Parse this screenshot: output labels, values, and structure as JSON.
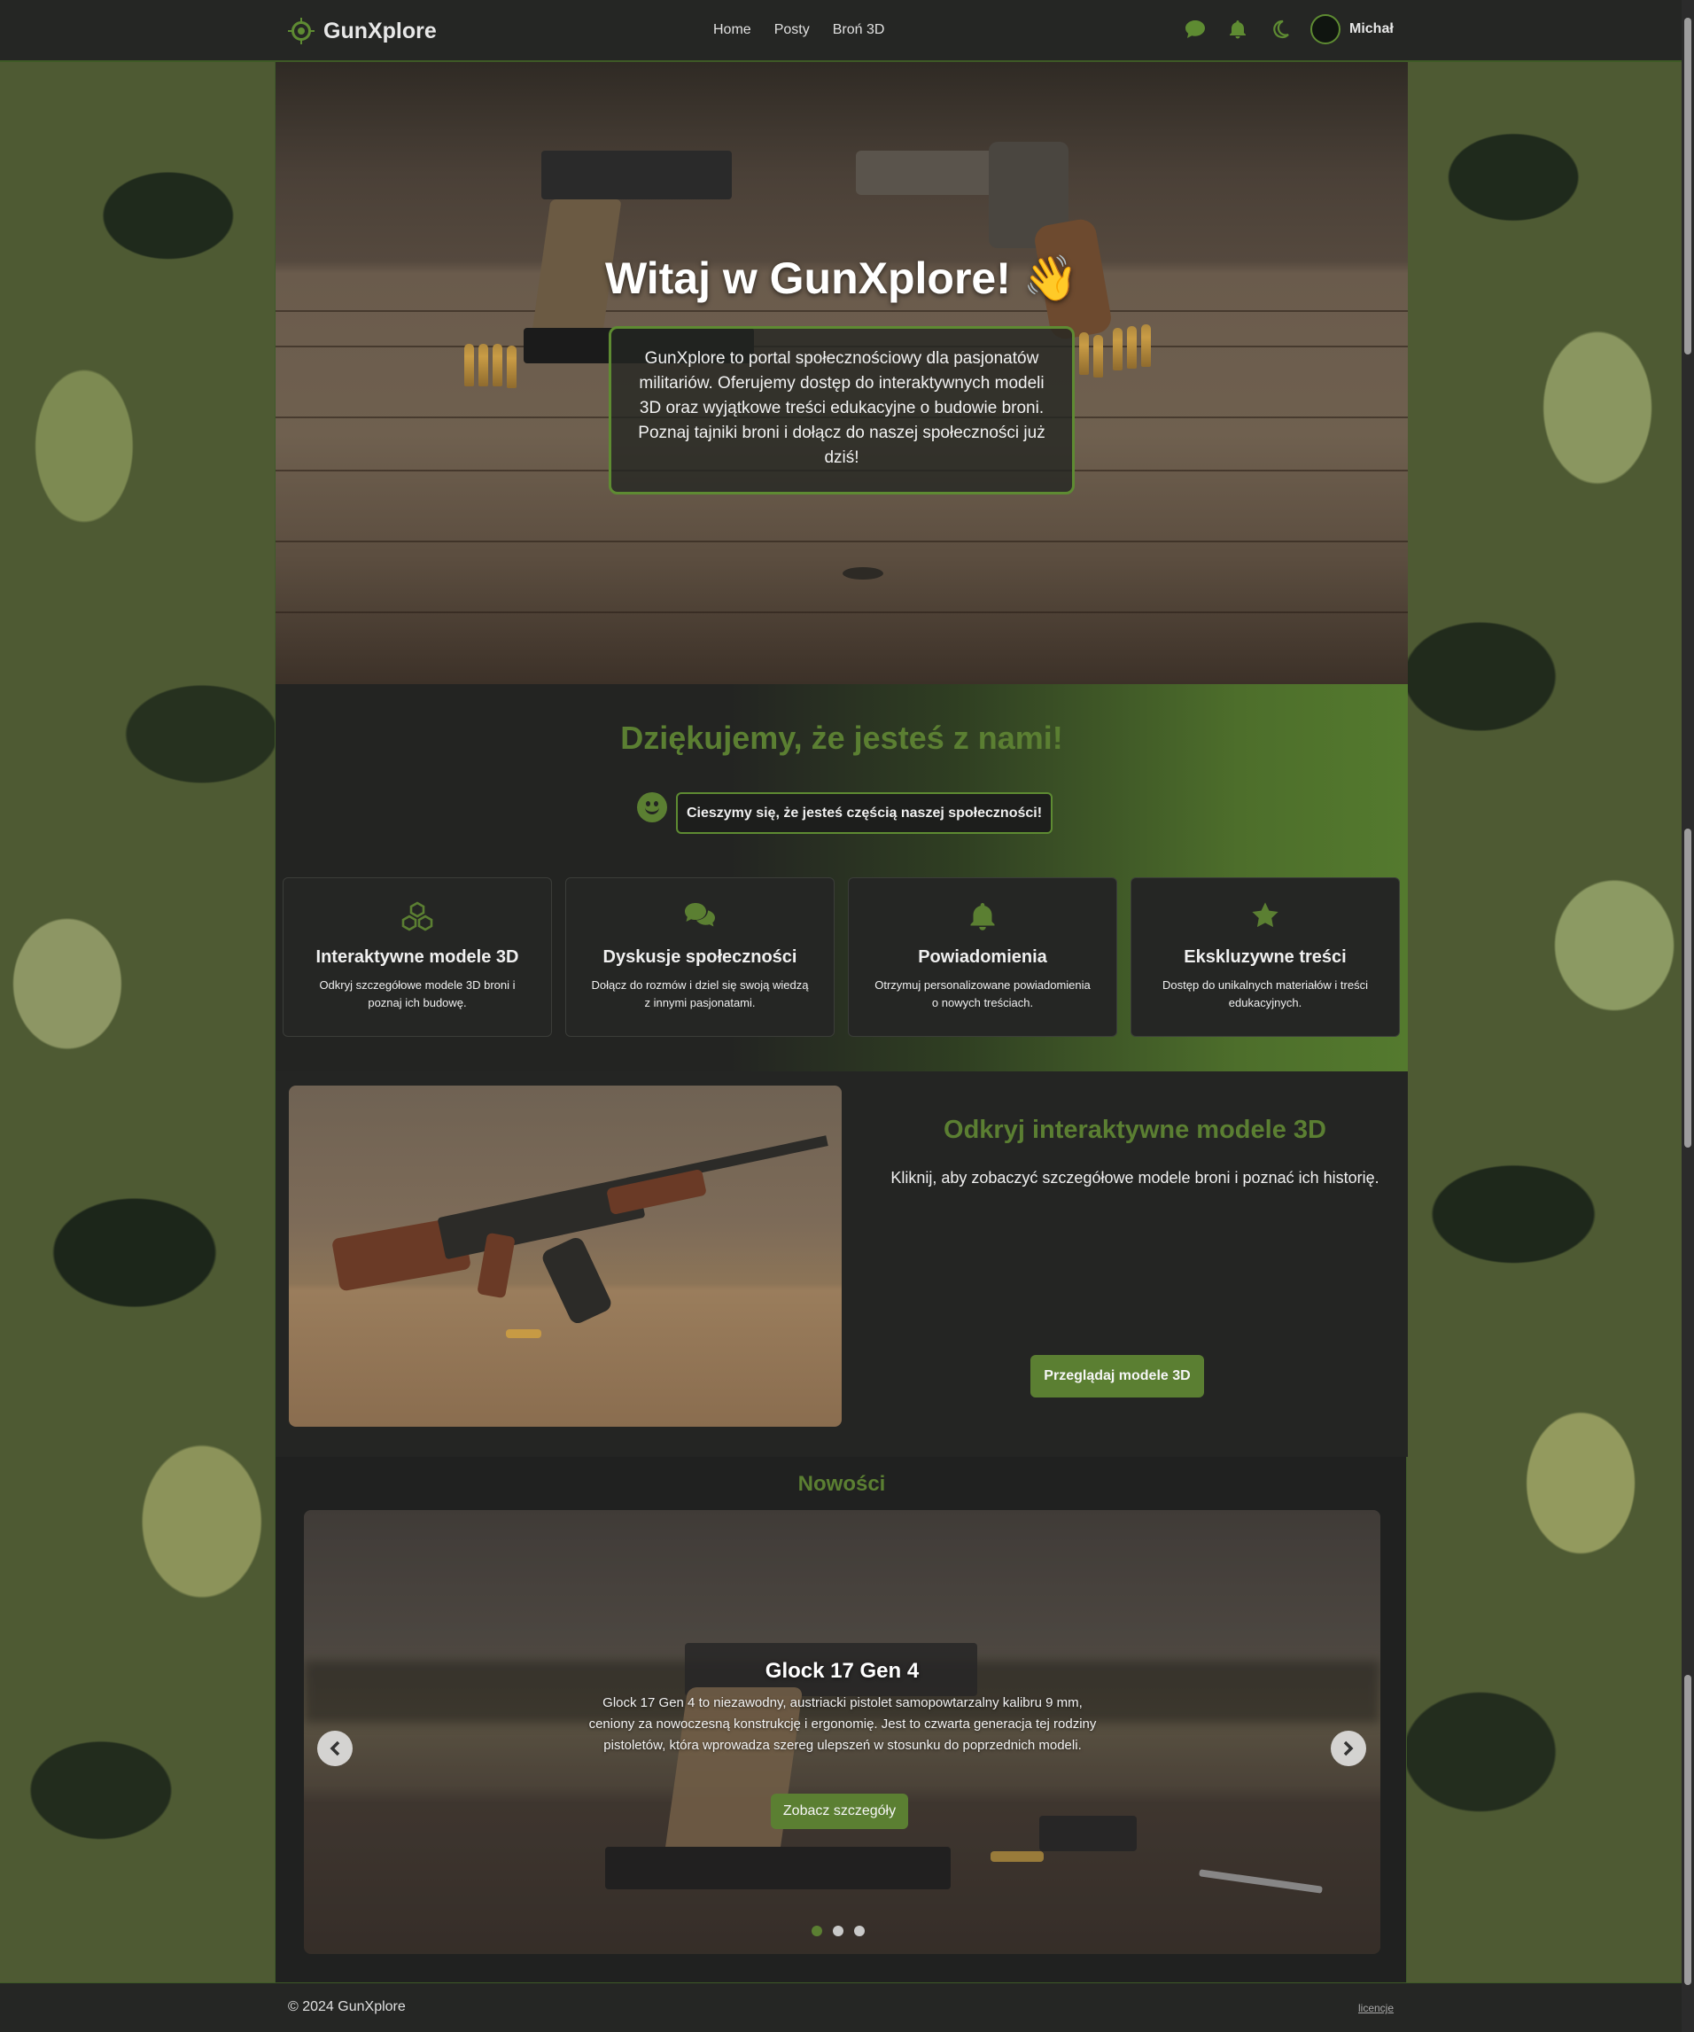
{
  "header": {
    "brand": "GunXplore",
    "nav": [
      "Home",
      "Posty",
      "Broń 3D"
    ],
    "icons": [
      "chat-icon",
      "bell-icon",
      "moon-icon"
    ],
    "user": "Michał"
  },
  "hero": {
    "title": "Witaj w GunXplore! 👋",
    "text": "GunXplore to portal społecznościowy dla pasjonatów militariów. Oferujemy dostęp do interaktywnych modeli 3D oraz wyjątkowe treści edukacyjne o budowie broni. Poznaj tajniki broni i dołącz do naszej społeczności już dziś!"
  },
  "thanks": {
    "title": "Dziękujemy, że jesteś z nami!",
    "pill": "Cieszymy się, że jesteś częścią naszej społeczności!"
  },
  "features": [
    {
      "icon": "cubes-icon",
      "title": "Interaktywne modele 3D",
      "text": "Odkryj szczegółowe modele 3D broni i poznaj ich budowę."
    },
    {
      "icon": "comments-icon",
      "title": "Dyskusje społeczności",
      "text": "Dołącz do rozmów i dziel się swoją wiedzą z innymi pasjonatami."
    },
    {
      "icon": "bell-icon",
      "title": "Powiadomienia",
      "text": "Otrzymuj personalizowane powiadomienia o nowych treściach."
    },
    {
      "icon": "star-icon",
      "title": "Ekskluzywne treści",
      "text": "Dostęp do unikalnych materiałów i treści edukacyjnych."
    }
  ],
  "models": {
    "title": "Odkryj interaktywne modele 3D",
    "text": "Kliknij, aby zobaczyć szczegółowe modele broni i poznać ich historię.",
    "button": "Przeglądaj modele 3D"
  },
  "news": {
    "title": "Nowości",
    "slide_title": "Glock 17 Gen 4",
    "slide_text": "Glock 17 Gen 4 to niezawodny, austriacki pistolet samopowtarzalny kalibru 9 mm, ceniony za nowoczesną konstrukcję i ergonomię. Jest to czwarta generacja tej rodziny pistoletów, która wprowadza szereg ulepszeń w stosunku do poprzednich modeli.",
    "slide_button": "Zobacz szczegóły",
    "slide_count": 3,
    "active_slide": 1
  },
  "footer": {
    "copyright": "© 2024 GunXplore",
    "license": "licencje"
  },
  "colors": {
    "accent": "#5b7f32",
    "background": "#202120"
  }
}
